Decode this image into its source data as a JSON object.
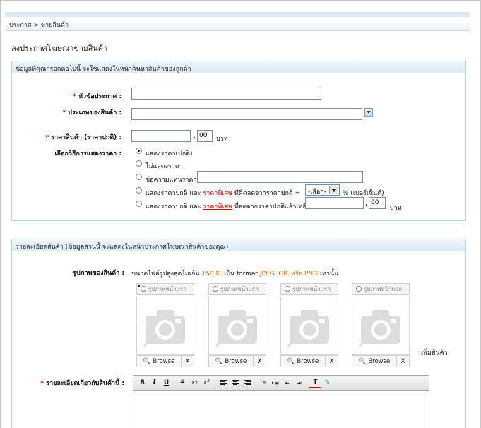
{
  "breadcrumb": "ประกาศ > ขายสินค้า",
  "page_title": "ลงประกาศโฆษณาขายสินค้า",
  "section1": {
    "header": "ข้อมูลที่คุณกรอกต่อไปนี้ จะใช้แสดงในหน้าค้นหาสินค้าของลูกค้า",
    "title_label": "หัวข้อประกาศ :",
    "type_label": "ประเภทของสินค้า :",
    "price_label": "ราคาสินค้า (ราคาปกติ) :",
    "price_decimal": "00",
    "price_unit": "บาท",
    "display_label": "เลือกวิธีการแสดงราคา :",
    "opt1": "แสดงราคา(ปกติ)",
    "opt2": "ไม่แสดงราคา",
    "opt3": "ข้อความแทนราคา",
    "opt4_a": "แสดงราคาปกติ และ",
    "opt4_link": "ราคาพิเศษ",
    "opt4_b": "ที่คิดลดจากราคาปกติ =",
    "opt4_select": "-เลือก-",
    "opt4_c": "% (เปอร์เซ็นต์)",
    "opt5_a": "แสดงราคาปกติ และ",
    "opt5_link": "ราคาพิเศษ",
    "opt5_b": "ที่ลดจากราคาปกติแล้วเหลือ",
    "opt5_decimal": "00",
    "opt5_unit": "บาท"
  },
  "section2": {
    "header": "รายละเอียดสินค้า (ข้อมูลส่วนนี้ จะแสดงในหน้าประกาศโฆษณาสินค้าของคุณ)",
    "photo_label": "รูปภาพของสินค้า :",
    "photo_note_a": "ขนาดไฟล์รูปสูงสุดไม่เกิน",
    "photo_note_size": "150 K.",
    "photo_note_b": "เป็น format",
    "photo_note_formats": "JPEG, GIF หรือ PNG",
    "photo_note_c": "เท่านั้น",
    "photo_tab": "รูปภาพหน้าแรก",
    "browse": "Browse",
    "remove": "X",
    "add_product": "เพิ่มสินค้า",
    "detail_label": "รายละเอียดเกี่ยวกับสินค้านี้ :"
  },
  "toolbar": {
    "bold": "B",
    "italic": "I",
    "underline": "U",
    "strike": "S",
    "subscript": "x₂",
    "superscript": "x²"
  },
  "colors": {
    "required": "#dd0000",
    "link": "#dd0000",
    "highlight": "#e07000",
    "section_border": "#b9d3ea"
  }
}
